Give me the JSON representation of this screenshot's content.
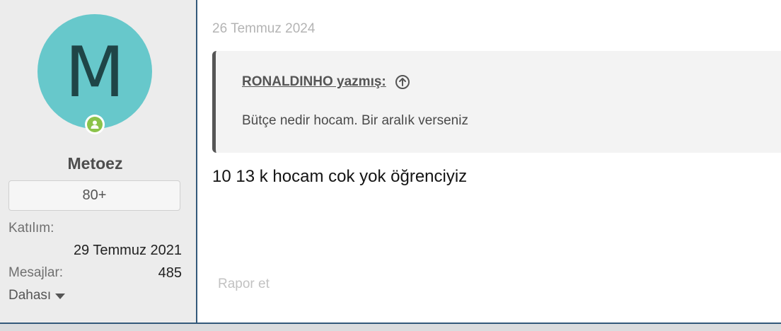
{
  "user": {
    "avatar_letter": "M",
    "name": "Metoez",
    "badge": "80+",
    "online": true
  },
  "meta": {
    "joined_label": "Katılım:",
    "joined_value": "29 Temmuz 2021",
    "messages_label": "Mesajlar:",
    "messages_value": "485",
    "more_label": "Dahası"
  },
  "post": {
    "date": "26 Temmuz 2024",
    "quote_author": "RONALDINHO yazmış:",
    "quote_text": "Bütçe nedir hocam. Bir aralık verseniz",
    "message": "10 13 k hocam cok yok öğrenciyiz",
    "report_label": "Rapor et"
  },
  "colors": {
    "avatar_bg": "#67c8cb",
    "avatar_text": "#1f4547",
    "online": "#8bc34a",
    "accent_border": "#33597a"
  },
  "icons": {
    "quote_jump": "circle-arrow-up-icon",
    "more": "caret-down-icon",
    "online": "user-online-icon"
  }
}
